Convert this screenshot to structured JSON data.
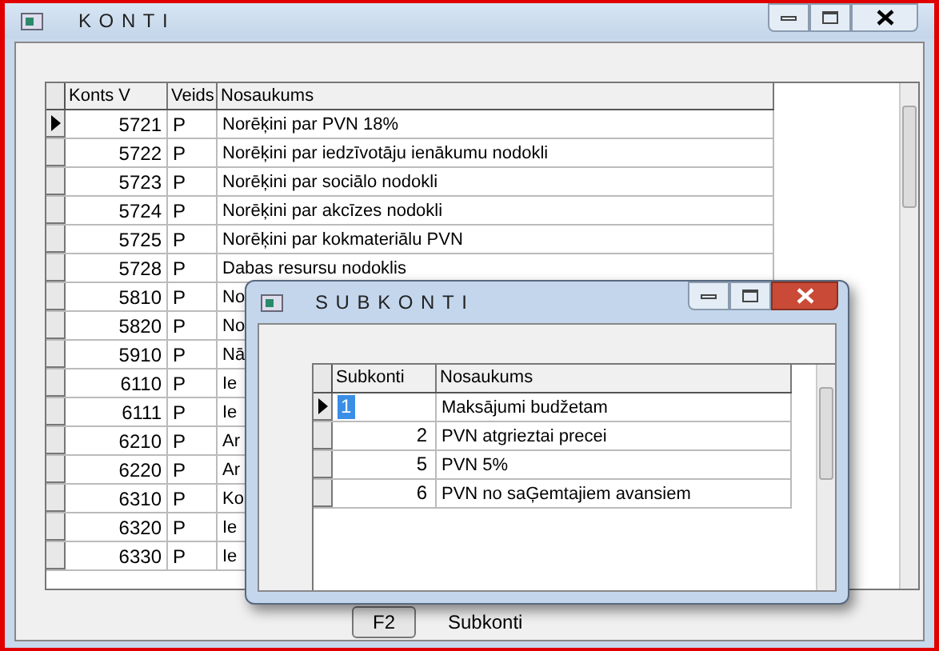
{
  "window": {
    "title": "KONTI"
  },
  "accounts": {
    "columns": [
      "Konts V",
      "Veids",
      "Nosaukums"
    ],
    "rows": [
      {
        "konts": "5721",
        "veids": "P",
        "nosaukums": "Norēķini par PVN 18%",
        "selected": true
      },
      {
        "konts": "5722",
        "veids": "P",
        "nosaukums": "Norēķini par iedzīvotāju ienākumu nodokli",
        "selected": false
      },
      {
        "konts": "5723",
        "veids": "P",
        "nosaukums": "Norēķini par sociālo nodokli",
        "selected": false
      },
      {
        "konts": "5724",
        "veids": "P",
        "nosaukums": "Norēķini par akcīzes nodokli",
        "selected": false
      },
      {
        "konts": "5725",
        "veids": "P",
        "nosaukums": "Norēķini par kokmateriālu PVN",
        "selected": false
      },
      {
        "konts": "5728",
        "veids": "P",
        "nosaukums": "Dabas resursu nodoklis",
        "selected": false
      },
      {
        "konts": "5810",
        "veids": "P",
        "nosaukums": "No",
        "selected": false
      },
      {
        "konts": "5820",
        "veids": "P",
        "nosaukums": "No",
        "selected": false
      },
      {
        "konts": "5910",
        "veids": "P",
        "nosaukums": "Nā",
        "selected": false
      },
      {
        "konts": "6110",
        "veids": "P",
        "nosaukums": "Ie",
        "selected": false
      },
      {
        "konts": "6111",
        "veids": "P",
        "nosaukums": "Ie",
        "selected": false
      },
      {
        "konts": "6210",
        "veids": "P",
        "nosaukums": "Ar",
        "selected": false
      },
      {
        "konts": "6220",
        "veids": "P",
        "nosaukums": "Ar",
        "selected": false
      },
      {
        "konts": "6310",
        "veids": "P",
        "nosaukums": "Ko",
        "selected": false
      },
      {
        "konts": "6320",
        "veids": "P",
        "nosaukums": "Ie",
        "selected": false
      },
      {
        "konts": "6330",
        "veids": "P",
        "nosaukums": "Ie",
        "selected": false
      }
    ]
  },
  "footer": {
    "key": "F2",
    "label": "Subkonti"
  },
  "dialog": {
    "title": "SUBKONTI",
    "columns": [
      "Subkonti",
      "Nosaukums"
    ],
    "rows": [
      {
        "subkonti": "1",
        "nosaukums": "Maksājumi budžetam",
        "selected": true
      },
      {
        "subkonti": "2",
        "nosaukums": "PVN atgrieztai precei",
        "selected": false
      },
      {
        "subkonti": "5",
        "nosaukums": "PVN 5%",
        "selected": false
      },
      {
        "subkonti": "6",
        "nosaukums": "PVN no saĢemtajiem avansiem",
        "selected": false
      }
    ]
  }
}
